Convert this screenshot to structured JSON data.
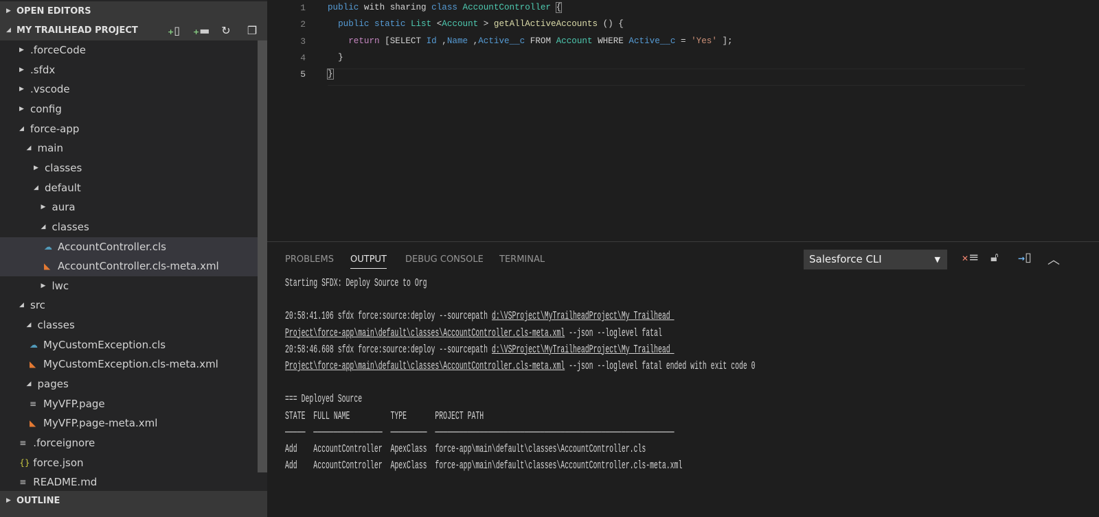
{
  "sidebar": {
    "open_editors": "OPEN EDITORS",
    "project": "MY TRAILHEAD PROJECT",
    "project_tools": [
      "new-file-icon",
      "new-folder-icon",
      "refresh-icon",
      "collapse-all-icon"
    ],
    "outline": "OUTLINE",
    "tree": [
      {
        "label": ".forceCode",
        "depth": 0,
        "type": "folder",
        "open": false
      },
      {
        "label": ".sfdx",
        "depth": 0,
        "type": "folder",
        "open": false
      },
      {
        "label": ".vscode",
        "depth": 0,
        "type": "folder",
        "open": false
      },
      {
        "label": "config",
        "depth": 0,
        "type": "folder",
        "open": false
      },
      {
        "label": "force-app",
        "depth": 0,
        "type": "folder",
        "open": true
      },
      {
        "label": "main",
        "depth": 1,
        "type": "folder",
        "open": true
      },
      {
        "label": "classes",
        "depth": 2,
        "type": "folder",
        "open": false
      },
      {
        "label": "default",
        "depth": 2,
        "type": "folder",
        "open": true
      },
      {
        "label": "aura",
        "depth": 3,
        "type": "folder",
        "open": false
      },
      {
        "label": "classes",
        "depth": 3,
        "type": "folder",
        "open": true
      },
      {
        "label": "AccountController.cls",
        "depth": 4,
        "type": "apex",
        "selected": true
      },
      {
        "label": "AccountController.cls-meta.xml",
        "depth": 4,
        "type": "xml",
        "selected": true
      },
      {
        "label": "lwc",
        "depth": 3,
        "type": "folder",
        "open": false
      },
      {
        "label": "src",
        "depth": 0,
        "type": "folder",
        "open": true
      },
      {
        "label": "classes",
        "depth": 1,
        "type": "folder",
        "open": true
      },
      {
        "label": "MyCustomException.cls",
        "depth": 2,
        "type": "apex"
      },
      {
        "label": "MyCustomException.cls-meta.xml",
        "depth": 2,
        "type": "xml"
      },
      {
        "label": "pages",
        "depth": 1,
        "type": "folder",
        "open": true
      },
      {
        "label": "MyVFP.page",
        "depth": 2,
        "type": "page"
      },
      {
        "label": "MyVFP.page-meta.xml",
        "depth": 2,
        "type": "xml"
      },
      {
        "label": ".forceignore",
        "depth": 0.6,
        "type": "page"
      },
      {
        "label": "force.json",
        "depth": 0.6,
        "type": "json"
      },
      {
        "label": "README.md",
        "depth": 0.6,
        "type": "page"
      }
    ]
  },
  "editor": {
    "line_numbers": [
      "1",
      "2",
      "3",
      "4",
      "5"
    ],
    "lines": [
      [
        [
          "k",
          "public"
        ],
        [
          "",
          "with sharing "
        ],
        [
          "k",
          "class"
        ],
        [
          "",
          ""
        ],
        [
          "t",
          "AccountController"
        ],
        [
          "",
          ""
        ],
        [
          "brk",
          "{"
        ]
      ],
      [
        [
          "",
          ""
        ],
        [
          "k",
          "public static"
        ],
        [
          "",
          ""
        ],
        [
          "t",
          "List"
        ],
        [
          "",
          "<"
        ],
        [
          "t",
          "Account"
        ],
        [
          "",
          "> "
        ],
        [
          "f",
          "getAllActiveAccounts"
        ],
        [
          "",
          "() {"
        ]
      ],
      [
        [
          "",
          ""
        ],
        [
          "r",
          "return"
        ],
        [
          "",
          "[SELECT "
        ],
        [
          "k",
          "Id"
        ],
        [
          "",
          ","
        ],
        [
          "k",
          "Name"
        ],
        [
          "",
          ","
        ],
        [
          "k",
          "Active__c"
        ],
        [
          "",
          ""
        ],
        [
          "",
          "FROM "
        ],
        [
          "t",
          "Account"
        ],
        [
          "",
          ""
        ],
        [
          "",
          "WHERE "
        ],
        [
          "k",
          "Active__c"
        ],
        [
          "",
          "= "
        ],
        [
          "s",
          "'Yes'"
        ],
        [
          "",
          "];"
        ]
      ],
      [
        [
          "",
          "  }"
        ]
      ],
      [
        [
          "brk",
          "}"
        ]
      ]
    ]
  },
  "panel": {
    "tabs": [
      "PROBLEMS",
      "OUTPUT",
      "DEBUG CONSOLE",
      "TERMINAL"
    ],
    "active_tab": "OUTPUT",
    "channel": "Salesforce CLI",
    "icons": [
      "clear-output-icon",
      "lock-scroll-icon",
      "open-log-icon",
      "maximize-panel-icon"
    ],
    "output": [
      "Starting SFDX: Deploy Source to Org",
      "",
      "20:58:41.106 sfdx force:source:deploy --sourcepath |d:\\VSProject\\MyTrailheadProject\\My Trailhead |",
      "|Project\\force-app\\main\\default\\classes\\AccountController.cls-meta.xml| --json --loglevel fatal",
      "20:58:46.608 sfdx force:source:deploy --sourcepath |d:\\VSProject\\MyTrailheadProject\\My Trailhead |",
      "|Project\\force-app\\main\\default\\classes\\AccountController.cls-meta.xml| --json --loglevel fatal ended with exit code 0",
      "",
      "=== Deployed Source",
      "STATE  FULL NAME          TYPE       PROJECT PATH",
      "─────  ─────────────────  ─────────  ───────────────────────────────────────────────────────────",
      "Add    AccountController  ApexClass  force-app\\main\\default\\classes\\AccountController.cls",
      "Add    AccountController  ApexClass  force-app\\main\\default\\classes\\AccountController.cls-meta.xml"
    ]
  }
}
